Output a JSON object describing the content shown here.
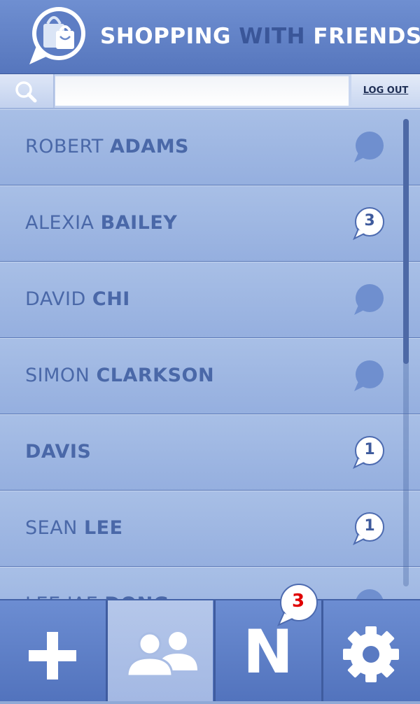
{
  "header": {
    "title_part1": "SHOPPING",
    "title_part2": "WITH",
    "title_part3": "FRIENDS",
    "logo_icon": "shopping-bag-speech-bubble-icon"
  },
  "search": {
    "placeholder": "",
    "value": "",
    "icon": "search-icon"
  },
  "logout_label": "LOG OUT",
  "friends": [
    {
      "first": "ROBERT",
      "last": "ADAMS",
      "count": ""
    },
    {
      "first": "ALEXIA",
      "last": "BAILEY",
      "count": "3"
    },
    {
      "first": "DAVID",
      "last": "CHI",
      "count": ""
    },
    {
      "first": "SIMON",
      "last": "CLARKSON",
      "count": ""
    },
    {
      "first": "",
      "last": "DAVIS",
      "count": "1"
    },
    {
      "first": "SEAN",
      "last": "LEE",
      "count": "1"
    },
    {
      "first": "LEE JAE",
      "last": "DONG",
      "count": ""
    }
  ],
  "nav": {
    "add_icon": "plus-icon",
    "friends_icon": "people-icon",
    "notifications_letter": "N",
    "notifications_count": "3",
    "settings_icon": "gear-icon"
  },
  "colors": {
    "header": "#5f80c6",
    "row": "#9db5e1",
    "name_text": "#4a68a8",
    "notif_count": "#e00000"
  }
}
